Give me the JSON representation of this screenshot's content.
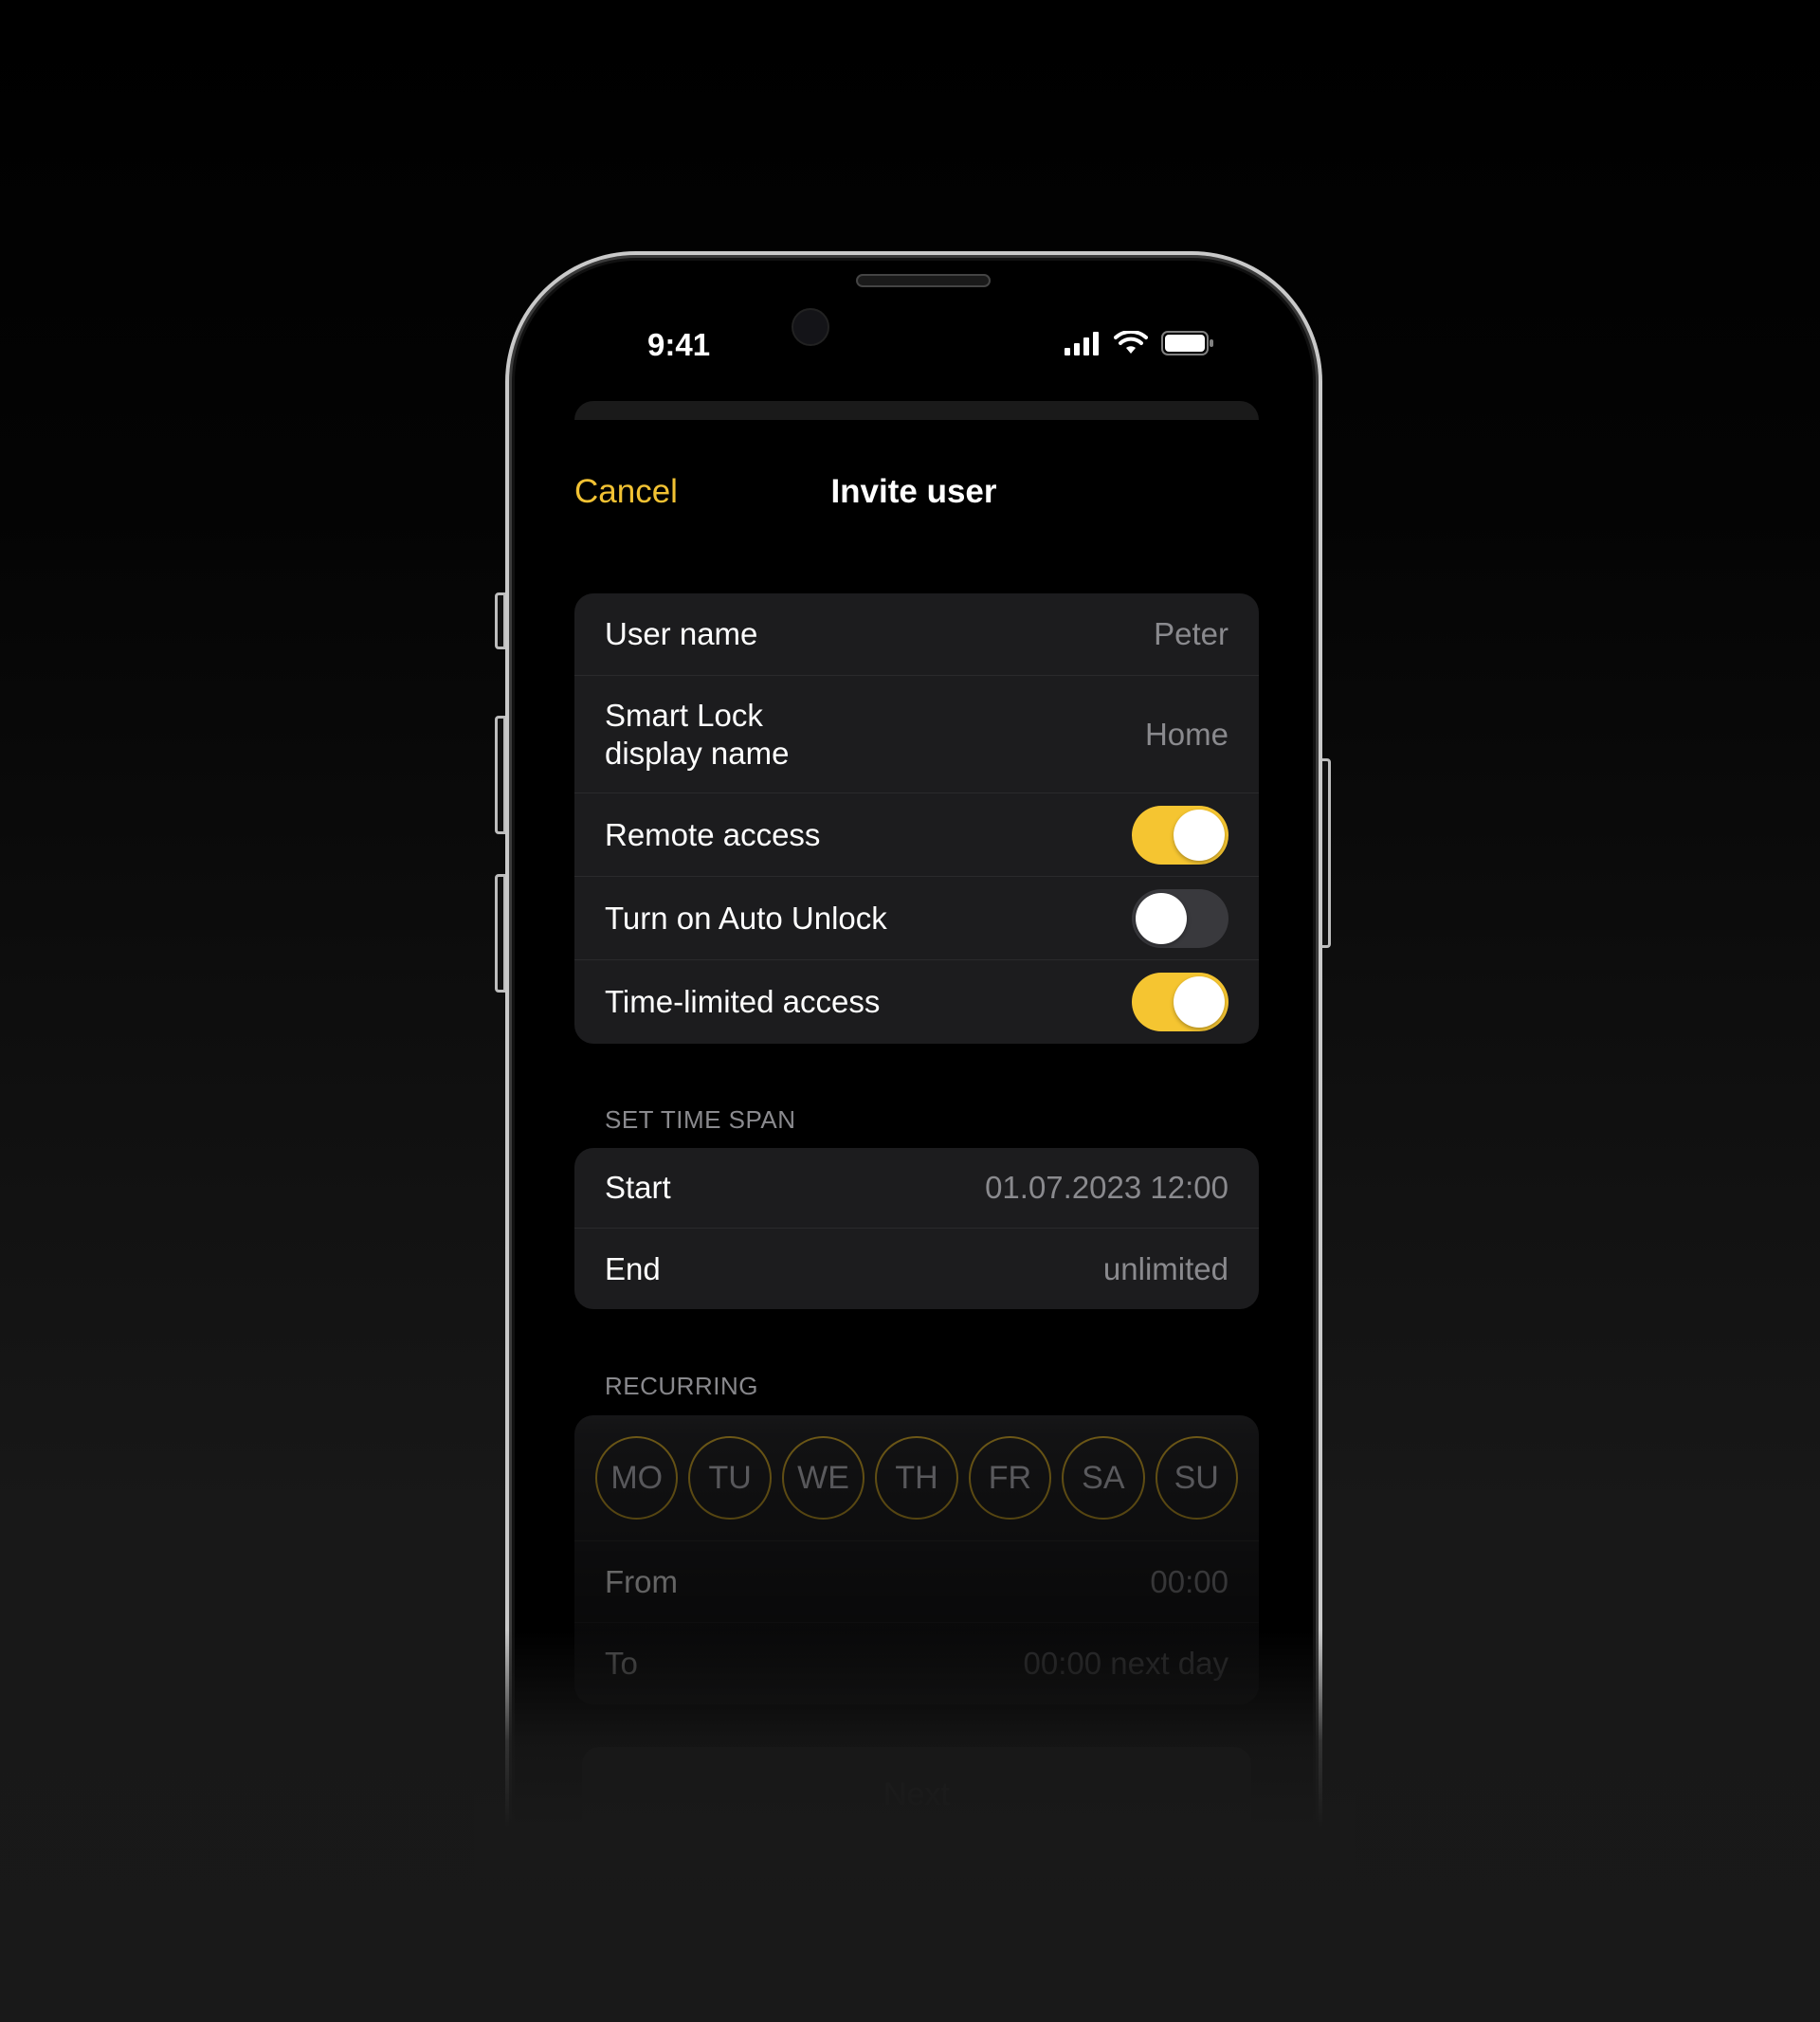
{
  "status_bar": {
    "time": "9:41"
  },
  "nav": {
    "cancel": "Cancel",
    "title": "Invite user"
  },
  "settings": {
    "user_name_label": "User name",
    "user_name_value": "Peter",
    "display_name_label_line1": "Smart Lock",
    "display_name_label_line2": "display name",
    "display_name_value": "Home",
    "remote_access_label": "Remote access",
    "remote_access_on": true,
    "auto_unlock_label": "Turn on Auto Unlock",
    "auto_unlock_on": false,
    "time_limited_label": "Time-limited access",
    "time_limited_on": true
  },
  "time_span": {
    "section_label": "SET TIME SPAN",
    "start_label": "Start",
    "start_value": "01.07.2023 12:00",
    "end_label": "End",
    "end_value": "unlimited"
  },
  "recurring": {
    "section_label": "RECURRING",
    "days": [
      "MO",
      "TU",
      "WE",
      "TH",
      "FR",
      "SA",
      "SU"
    ],
    "from_label": "From",
    "from_value": "00:00",
    "to_label": "To",
    "to_value": "00:00 next day"
  },
  "footer": {
    "next_label": "Next"
  },
  "colors": {
    "accent": "#f5c531",
    "background": "#000000",
    "card": "#1c1c1e"
  }
}
